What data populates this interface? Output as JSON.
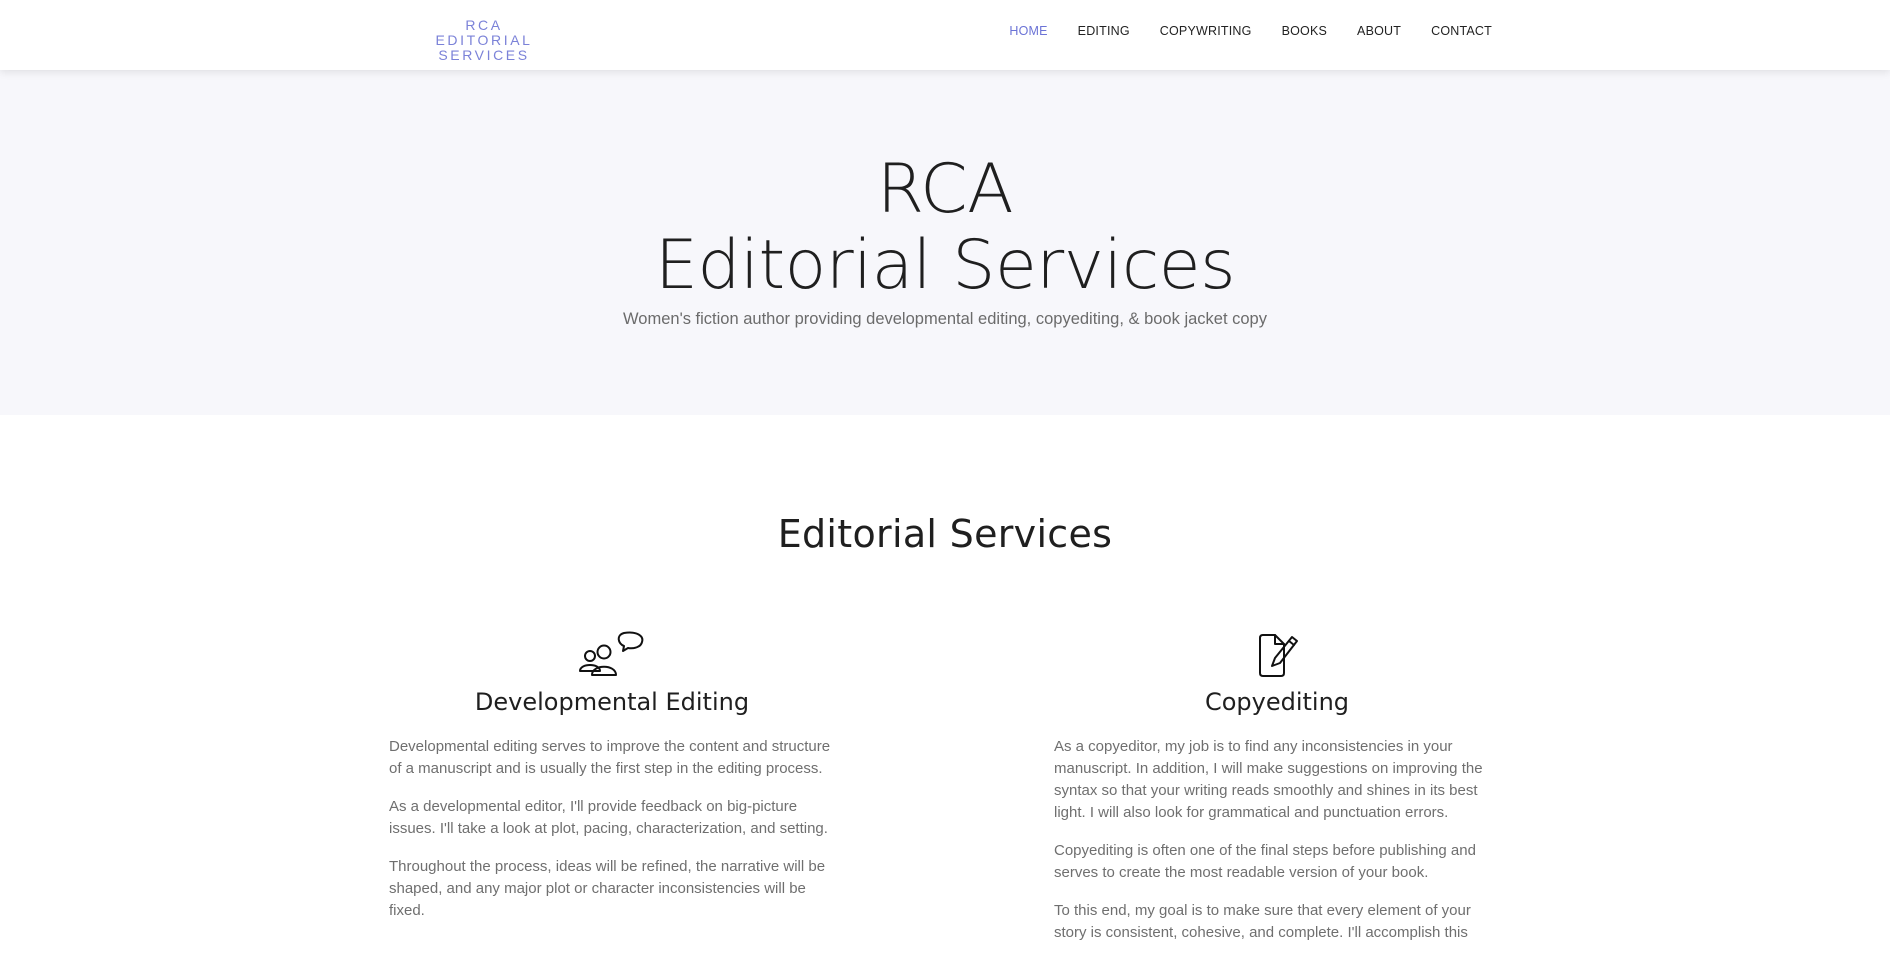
{
  "brand": {
    "line1": "RCA",
    "line2": "EDITORIAL SERVICES"
  },
  "nav": {
    "home": "HOME",
    "editing": "EDITING",
    "copywriting": "COPYWRITING",
    "books": "BOOKS",
    "about": "ABOUT",
    "contact": "CONTACT"
  },
  "hero": {
    "title_line1": "RCA",
    "title_line2": "Editorial Services",
    "subtitle": "Women's fiction author providing developmental editing, copyediting, & book jacket copy"
  },
  "services": {
    "title": "Editorial Services",
    "developmental": {
      "icon": "people-chat-icon",
      "heading": "Developmental Editing",
      "p1": "Developmental editing serves to improve the content and structure of a manuscript and is usually the first step in the editing process.",
      "p2": "As a developmental editor, I'll provide feedback on big-picture issues. I'll take a look at plot, pacing, characterization, and setting.",
      "p3": "Throughout the process, ideas will be refined, the narrative will be shaped, and any major plot or character inconsistencies will be fixed."
    },
    "copyediting": {
      "icon": "document-pen-icon",
      "heading": "Copyediting",
      "p1": "As a copyeditor, my job is to find any inconsistencies in your manuscript. In addition, I will make suggestions on improving the syntax so that your writing reads smoothly and shines in its best light. I will also look for grammatical and punctuation errors.",
      "p2": "Copyediting is often one of the final steps before publishing and serves to create the most readable version of your book.",
      "p3": "To this end, my goal is to make sure that every element of your story is consistent, cohesive, and complete. I'll accomplish this"
    }
  },
  "colors": {
    "accent": "#6b73d6",
    "hero_bg": "#f7f7fb",
    "text_dark": "#1f1f1f",
    "text_muted": "#6f6f6f"
  }
}
